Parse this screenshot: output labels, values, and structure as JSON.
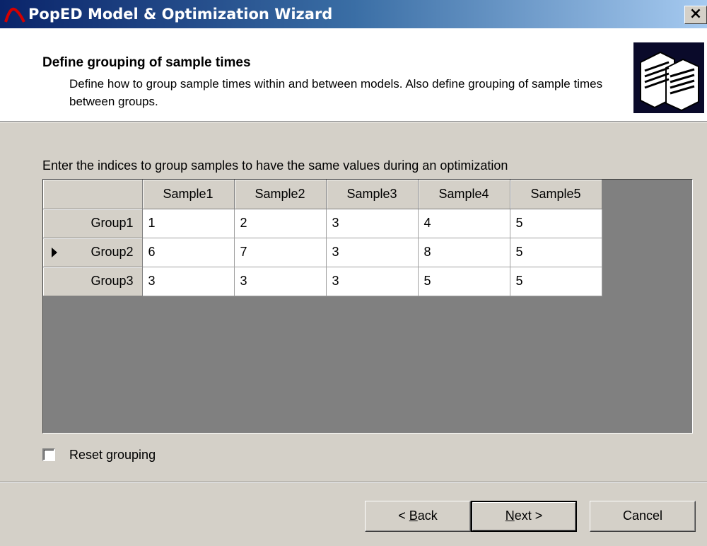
{
  "window": {
    "title": "PopED Model & Optimization Wizard",
    "close_glyph": "×"
  },
  "header": {
    "title": "Define grouping of sample times",
    "description": "Define how to group sample times within and between models. Also define grouping of sample times between groups.",
    "icon": "servers-icon"
  },
  "grid": {
    "instruction": "Enter the indices to group samples to have the same values during an optimization",
    "columns": [
      "Sample1",
      "Sample2",
      "Sample3",
      "Sample4",
      "Sample5"
    ],
    "rows": [
      {
        "label": "Group1",
        "current": false,
        "values": [
          "1",
          "2",
          "3",
          "4",
          "5"
        ]
      },
      {
        "label": "Group2",
        "current": true,
        "values": [
          "6",
          "7",
          "3",
          "8",
          "5"
        ]
      },
      {
        "label": "Group3",
        "current": false,
        "values": [
          "3",
          "3",
          "3",
          "5",
          "5"
        ]
      }
    ]
  },
  "options": {
    "reset_grouping_label": "Reset grouping",
    "reset_grouping_checked": false
  },
  "buttons": {
    "back_prefix": "< ",
    "back_key": "B",
    "back_rest": "ack",
    "next_key": "N",
    "next_rest": "ext >",
    "cancel": "Cancel"
  },
  "colors": {
    "titlebar_start": "#0a246a",
    "titlebar_end": "#a6caf0",
    "dialog_bg": "#d4d0c8",
    "grid_bg": "#808080",
    "logo_red": "#d40000"
  }
}
